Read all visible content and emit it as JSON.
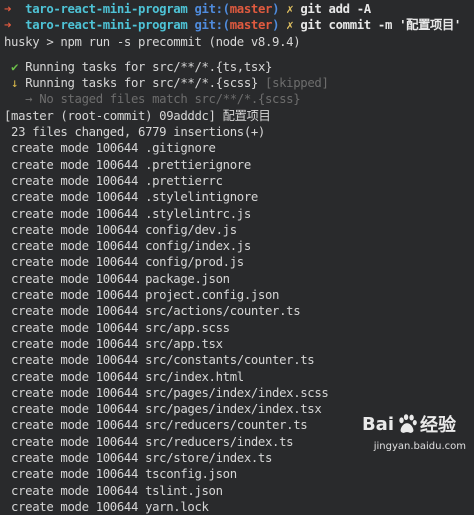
{
  "prompt1": {
    "arrow": "➜",
    "repo": "taro-react-mini-program",
    "git": "git:(",
    "branch": "master",
    "close": ")",
    "x": "✗",
    "command": "git add -A"
  },
  "prompt2": {
    "arrow": "➜",
    "repo": "taro-react-mini-program",
    "git": "git:(",
    "branch": "master",
    "close": ")",
    "x": "✗",
    "command": "git commit -m '配置项目'"
  },
  "husky_line": "husky > npm run -s precommit (node v8.9.4)",
  "tasks": [
    {
      "icon": "✔",
      "text": "Running tasks for src/**/*.{ts,tsx}",
      "note": ""
    },
    {
      "icon": "↓",
      "text": "Running tasks for src/**/*.{scss}",
      "note": "[skipped]"
    }
  ],
  "no_staged": "→ No staged files match src/**/*.{scss}",
  "commit_line": "[master (root-commit) 09adddc] 配置项目",
  "summary_line": " 23 files changed, 6779 insertions(+)",
  "create_prefix": " create mode 100644 ",
  "files": [
    ".gitignore",
    ".prettierignore",
    ".prettierrc",
    ".stylelintignore",
    ".stylelintrc.js",
    "config/dev.js",
    "config/index.js",
    "config/prod.js",
    "package.json",
    "project.config.json",
    "src/actions/counter.ts",
    "src/app.scss",
    "src/app.tsx",
    "src/constants/counter.ts",
    "src/index.html",
    "src/pages/index/index.scss",
    "src/pages/index/index.tsx",
    "src/reducers/counter.ts",
    "src/reducers/index.ts",
    "src/store/index.ts",
    "tsconfig.json",
    "tslint.json",
    "yarn.lock"
  ],
  "watermark": {
    "brand": "Bai",
    "brand2": "经验",
    "url": "jingyan.baidu.com"
  }
}
